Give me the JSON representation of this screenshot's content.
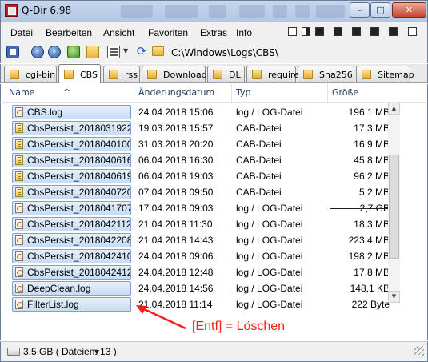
{
  "window": {
    "title": "Q-Dir 6.98",
    "controls": {
      "minimize": "–",
      "maximize": "□",
      "close": "✕"
    }
  },
  "menu": {
    "items": [
      "Datei",
      "Bearbeiten",
      "Ansicht",
      "Favoriten",
      "Extras",
      "Info"
    ]
  },
  "toolbar": {
    "address": "C:\\Windows\\Logs\\CBS\\",
    "icons": [
      "view-menu-icon",
      "back-icon",
      "forward-icon",
      "up-folder-icon",
      "favorites-folder-icon",
      "view-mode-icon",
      "refresh-icon"
    ]
  },
  "tabs": [
    {
      "label": "cgi-bin",
      "active": false
    },
    {
      "label": "CBS",
      "active": true
    },
    {
      "label": "rss",
      "active": false
    },
    {
      "label": "Download",
      "active": false
    },
    {
      "label": "DL",
      "active": false
    },
    {
      "label": "require",
      "active": false
    },
    {
      "label": "Sha256",
      "active": false
    },
    {
      "label": "Sitemap",
      "active": false
    }
  ],
  "columns": {
    "name": "Name",
    "modified": "Änderungsdatum",
    "type": "Typ",
    "size": "Größe"
  },
  "files": [
    {
      "name": "CBS.log",
      "date": "24.04.2018 15:06",
      "type": "log / LOG-Datei",
      "size": "196,1 MB",
      "kind": "log"
    },
    {
      "name": "CbsPersist_2018031922...",
      "date": "19.03.2018 15:57",
      "type": "CAB-Datei",
      "size": "17,3 MB",
      "kind": "cab"
    },
    {
      "name": "CbsPersist_2018040100...",
      "date": "31.03.2018 20:20",
      "type": "CAB-Datei",
      "size": "16,9 MB",
      "kind": "cab"
    },
    {
      "name": "CbsPersist_2018040616...",
      "date": "06.04.2018 16:30",
      "type": "CAB-Datei",
      "size": "45,8 MB",
      "kind": "cab"
    },
    {
      "name": "CbsPersist_2018040619...",
      "date": "06.04.2018 19:03",
      "type": "CAB-Datei",
      "size": "96,2 MB",
      "kind": "cab"
    },
    {
      "name": "CbsPersist_2018040720...",
      "date": "07.04.2018 09:50",
      "type": "CAB-Datei",
      "size": "5,2 MB",
      "kind": "cab"
    },
    {
      "name": "CbsPersist_2018041707...",
      "date": "17.04.2018 09:03",
      "type": "log / LOG-Datei",
      "size": "2,7 GB",
      "kind": "log"
    },
    {
      "name": "CbsPersist_2018042112...",
      "date": "21.04.2018 11:30",
      "type": "log / LOG-Datei",
      "size": "18,3 MB",
      "kind": "log"
    },
    {
      "name": "CbsPersist_2018042208...",
      "date": "21.04.2018 14:43",
      "type": "log / LOG-Datei",
      "size": "223,4 MB",
      "kind": "log"
    },
    {
      "name": "CbsPersist_2018042410...",
      "date": "24.04.2018 09:06",
      "type": "log / LOG-Datei",
      "size": "198,2 MB",
      "kind": "log"
    },
    {
      "name": "CbsPersist_2018042412...",
      "date": "24.04.2018 12:48",
      "type": "log / LOG-Datei",
      "size": "17,8 MB",
      "kind": "log"
    },
    {
      "name": "DeepClean.log",
      "date": "24.04.2018 14:56",
      "type": "log / LOG-Datei",
      "size": "148,1 KB",
      "kind": "log"
    },
    {
      "name": "FilterList.log",
      "date": "21.04.2018 11:14",
      "type": "log / LOG-Datei",
      "size": "222 Byte",
      "kind": "log"
    }
  ],
  "annotation": {
    "text": "[Entf] = Löschen",
    "color": "#ff1a1a"
  },
  "status": {
    "text": "3,5 GB ( Dateien: 13 )"
  },
  "colors": {
    "selection_fill": "#c9dcf3",
    "selection_border": "#7da2ce",
    "header_text": "#1e395b"
  }
}
